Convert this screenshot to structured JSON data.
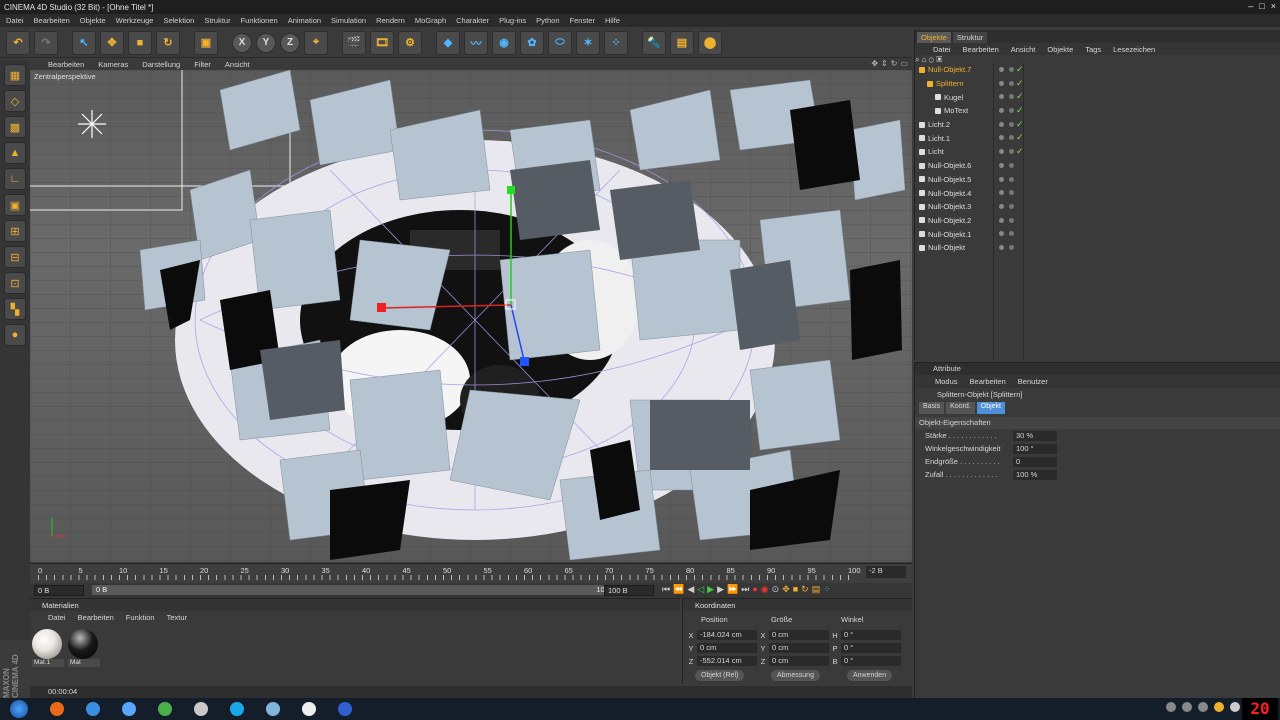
{
  "window": {
    "title": "CINEMA 4D Studio (32 Bit) - [Ohne Titel *]"
  },
  "menu": [
    "Datei",
    "Bearbeiten",
    "Objekte",
    "Werkzeuge",
    "Selektion",
    "Struktur",
    "Funktionen",
    "Animation",
    "Simulation",
    "Rendern",
    "MoGraph",
    "Charakter",
    "Plug-ins",
    "Python",
    "Fenster",
    "Hilfe"
  ],
  "viewport": {
    "menu": [
      "Bearbeiten",
      "Kameras",
      "Darstellung",
      "Filter",
      "Ansicht"
    ],
    "label": "Zentralperspektive"
  },
  "timeline": {
    "ticks": [
      "0",
      "5",
      "10",
      "15",
      "20",
      "25",
      "30",
      "35",
      "40",
      "45",
      "50",
      "55",
      "60",
      "65",
      "70",
      "75",
      "80",
      "85",
      "90",
      "95",
      "100"
    ],
    "current_frame": "-2 B",
    "start": "0 B",
    "range_start": "0 B",
    "range_end": "100 B",
    "end": "100 B"
  },
  "materials": {
    "title": "Materialien",
    "menu": [
      "Datei",
      "Bearbeiten",
      "Funktion",
      "Textur"
    ],
    "items": [
      {
        "name": "Mat.1",
        "color": "#e8e6df"
      },
      {
        "name": "Mat",
        "color": "#1a1a1a"
      }
    ]
  },
  "coords": {
    "title": "Koordinaten",
    "headers": [
      "Position",
      "Größe",
      "Winkel"
    ],
    "rows": [
      {
        "axis": "X",
        "pos": "-184.024 cm",
        "size_axis": "X",
        "size": "0 cm",
        "rot_axis": "H",
        "rot": "0 °"
      },
      {
        "axis": "Y",
        "pos": "0 cm",
        "size_axis": "Y",
        "size": "0 cm",
        "rot_axis": "P",
        "rot": "0 °"
      },
      {
        "axis": "Z",
        "pos": "-552.014 cm",
        "size_axis": "Z",
        "size": "0 cm",
        "rot_axis": "B",
        "rot": "0 °"
      }
    ],
    "btn_mode": "Objekt (Rel)",
    "btn_size": "Abmessung",
    "btn_apply": "Anwenden"
  },
  "status": {
    "time": "00:00:04"
  },
  "objects": {
    "tabs": [
      "Objekte",
      "Struktur"
    ],
    "menu": [
      "Datei",
      "Bearbeiten",
      "Ansicht",
      "Objekte",
      "Tags",
      "Lesezeichen"
    ],
    "items": [
      {
        "name": "Null-Objekt.7",
        "color": "#f0b030",
        "check": true
      },
      {
        "name": "Splittern",
        "color": "#f0b030",
        "check": true
      },
      {
        "name": "Kugel",
        "color": "#dddddd",
        "check": true
      },
      {
        "name": "MoText",
        "color": "#dddddd",
        "check": true
      },
      {
        "name": "Licht.2",
        "color": "#dddddd",
        "check": true
      },
      {
        "name": "Licht.1",
        "color": "#dddddd",
        "check": true
      },
      {
        "name": "Licht",
        "color": "#dddddd",
        "check": true
      },
      {
        "name": "Null-Objekt.6",
        "color": "#dddddd",
        "check": false
      },
      {
        "name": "Null-Objekt.5",
        "color": "#dddddd",
        "check": false
      },
      {
        "name": "Null-Objekt.4",
        "color": "#dddddd",
        "check": false
      },
      {
        "name": "Null-Objekt.3",
        "color": "#dddddd",
        "check": false
      },
      {
        "name": "Null-Objekt.2",
        "color": "#dddddd",
        "check": false
      },
      {
        "name": "Null-Objekt.1",
        "color": "#dddddd",
        "check": false
      },
      {
        "name": "Null-Objekt",
        "color": "#dddddd",
        "check": false
      }
    ]
  },
  "attributes": {
    "title": "Attribute",
    "menu": [
      "Modus",
      "Bearbeiten",
      "Benutzer"
    ],
    "object": "Splittern-Objekt [Splittern]",
    "tabs": [
      "Basis",
      "Koord.",
      "Objekt"
    ],
    "section": "Objekt-Eigenschaften",
    "props": [
      {
        "label": "Stärke . . . . . . . . . . . .",
        "value": "30 %"
      },
      {
        "label": "Winkelgeschwindigkeit",
        "value": "100 °"
      },
      {
        "label": "Endgröße . . . . . . . . . .",
        "value": "0"
      },
      {
        "label": "Zufall . . . . . . . . . . . . .",
        "value": "100 %"
      }
    ]
  },
  "clock": "20",
  "colors": {
    "accent": "#f0b030",
    "active_tab": "#4f8fd8",
    "check": "#7fe35a"
  }
}
